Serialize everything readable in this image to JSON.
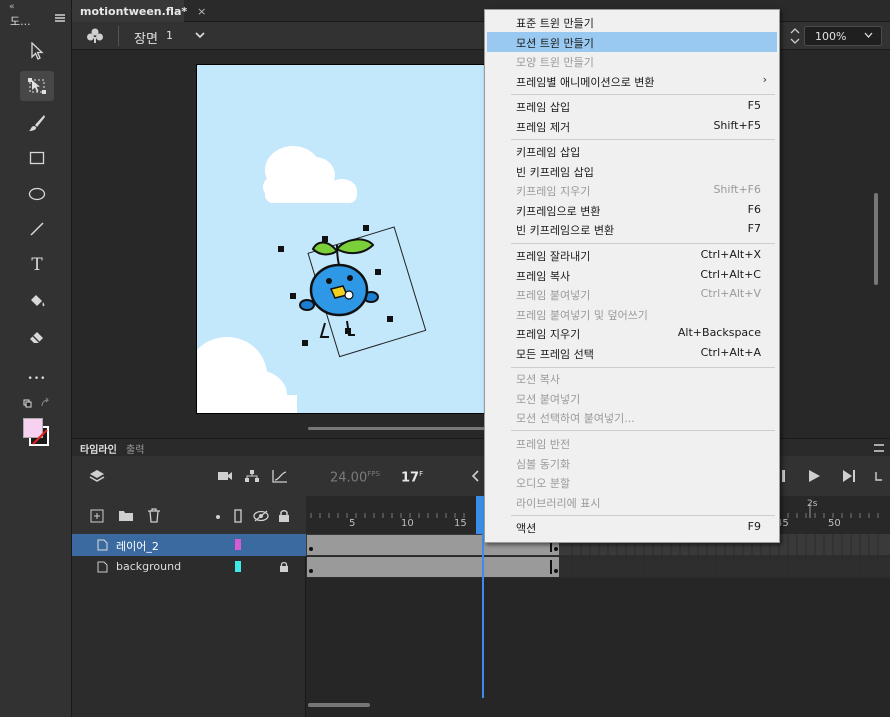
{
  "toolbar": {
    "collapse_glyph": "«",
    "title": "도...",
    "tools": [
      {
        "name": "selection-tool",
        "icon": "arrow-icon"
      },
      {
        "name": "free-transform-tool",
        "icon": "transform-icon",
        "active": true
      },
      {
        "name": "brush-tool",
        "icon": "brush-icon"
      },
      {
        "name": "rectangle-tool",
        "icon": "rectangle-icon"
      },
      {
        "name": "oval-tool",
        "icon": "oval-icon"
      },
      {
        "name": "line-tool",
        "icon": "line-icon"
      },
      {
        "name": "text-tool",
        "icon": "text-icon"
      },
      {
        "name": "paint-bucket-tool",
        "icon": "bucket-icon"
      },
      {
        "name": "eraser-tool",
        "icon": "eraser-icon"
      },
      {
        "name": "more-tools",
        "icon": "ellipsis-icon"
      }
    ],
    "more_label": "•••",
    "text_tool_glyph": "T",
    "fill_color": "#f7d2f0",
    "stroke_color": "#ffffff"
  },
  "document": {
    "tab_label": "motiontween.fla*",
    "close_glyph": "×"
  },
  "edit_bar": {
    "scene_label": "장면",
    "scene_number": "1",
    "zoom": "100%"
  },
  "timeline": {
    "tabs": [
      "타임라인",
      "출력"
    ],
    "fps": "24.00",
    "fps_unit": "FPS",
    "frame": "17",
    "frame_unit": "F",
    "ruler_labels": [
      "5",
      "10",
      "15",
      "45",
      "50"
    ],
    "time_label": "2s",
    "layers": [
      {
        "name": "레이어_2",
        "color": "#d65cd6",
        "selected": true
      },
      {
        "name": "background",
        "color": "#3ee8e8",
        "locked": true
      }
    ],
    "colors": {
      "selected_row": "#3b6aa0",
      "playhead": "#3b8ee8"
    }
  },
  "context_menu": {
    "items": [
      {
        "label": "표준 트윈 만들기",
        "shortcut": "",
        "disabled": false
      },
      {
        "label": "모션 트윈 만들기",
        "shortcut": "",
        "disabled": false,
        "highlight": true
      },
      {
        "label": "모양 트윈 만들기",
        "shortcut": "",
        "disabled": true
      },
      {
        "label": "프레임별 애니메이션으로 변환",
        "shortcut": "",
        "disabled": false,
        "submenu": true,
        "submenu_glyph": "›"
      },
      {
        "label": "프레임 삽입",
        "shortcut": "F5",
        "disabled": false
      },
      {
        "label": "프레임 제거",
        "shortcut": "Shift+F5",
        "disabled": false
      },
      {
        "label": "키프레임 삽입",
        "shortcut": "",
        "disabled": false
      },
      {
        "label": "빈 키프레임 삽입",
        "shortcut": "",
        "disabled": false
      },
      {
        "label": "키프레임 지우기",
        "shortcut": "Shift+F6",
        "disabled": true
      },
      {
        "label": "키프레임으로 변환",
        "shortcut": "F6",
        "disabled": false
      },
      {
        "label": "빈 키프레임으로 변환",
        "shortcut": "F7",
        "disabled": false
      },
      {
        "label": "프레임 잘라내기",
        "shortcut": "Ctrl+Alt+X",
        "disabled": false
      },
      {
        "label": "프레임 복사",
        "shortcut": "Ctrl+Alt+C",
        "disabled": false
      },
      {
        "label": "프레임 붙여넣기",
        "shortcut": "Ctrl+Alt+V",
        "disabled": true
      },
      {
        "label": "프레임 붙여넣기 및 덮어쓰기",
        "shortcut": "",
        "disabled": true
      },
      {
        "label": "프레임 지우기",
        "shortcut": "Alt+Backspace",
        "disabled": false
      },
      {
        "label": "모든 프레임 선택",
        "shortcut": "Ctrl+Alt+A",
        "disabled": false
      },
      {
        "label": "모션 복사",
        "shortcut": "",
        "disabled": true
      },
      {
        "label": "모션 붙여넣기",
        "shortcut": "",
        "disabled": true
      },
      {
        "label": "모션 선택하여 붙여넣기...",
        "shortcut": "",
        "disabled": true
      },
      {
        "label": "프레임 반전",
        "shortcut": "",
        "disabled": true
      },
      {
        "label": "심볼 동기화",
        "shortcut": "",
        "disabled": true
      },
      {
        "label": "오디오 분할",
        "shortcut": "",
        "disabled": true
      },
      {
        "label": "라이브러리에 표시",
        "shortcut": "",
        "disabled": true
      },
      {
        "label": "액션",
        "shortcut": "F9",
        "disabled": false
      }
    ]
  }
}
